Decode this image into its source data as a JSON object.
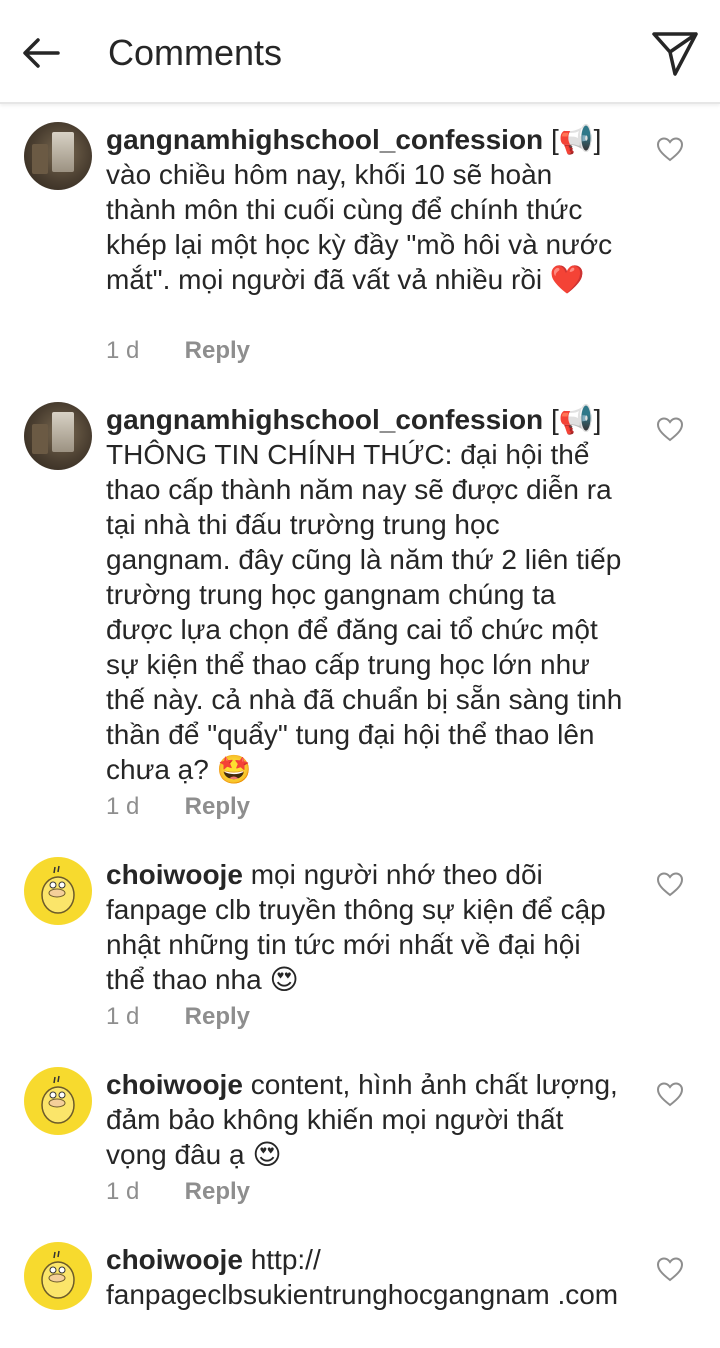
{
  "header": {
    "title": "Comments"
  },
  "comments": [
    {
      "username": "gangnamhighschool_confession",
      "prefix": "[📢]",
      "text": "vào chiều hôm nay, khối 10 sẽ hoàn thành môn thi cuối cùng để chính thức khép lại một học kỳ đầy \"mồ hôi và nước mắt\". mọi người đã vất vả nhiều rồi",
      "emoji": "❤️",
      "time": "1 d",
      "reply_label": "Reply"
    },
    {
      "username": "gangnamhighschool_confession",
      "prefix": "[📢]",
      "text": "THÔNG TIN CHÍNH THỨC: đại hội thể thao cấp thành năm nay sẽ được diễn ra tại nhà thi đấu trường trung học gangnam. đây cũng là năm thứ 2 liên tiếp trường trung học gangnam chúng ta được lựa chọn để đăng cai tổ chức một sự kiện thể thao cấp trung học lớn như thế này. cả nhà đã chuẩn bị sẵn sàng tinh thần để \"quẩy\" tung đại hội thể thao lên chưa ạ?",
      "emoji": "🤩",
      "time": "1 d",
      "reply_label": "Reply"
    },
    {
      "username": "choiwooje",
      "prefix": "",
      "text": "mọi người nhớ theo dõi fanpage clb truyền thông sự kiện để cập nhật những tin tức mới nhất về đại hội thể thao nha",
      "emoji": "😍",
      "time": "1 d",
      "reply_label": "Reply"
    },
    {
      "username": "choiwooje",
      "prefix": "",
      "text": "content, hình ảnh chất lượng, đảm bảo không khiến mọi người thất vọng đâu ạ",
      "emoji": "😍",
      "time": "1 d",
      "reply_label": "Reply"
    },
    {
      "username": "choiwooje",
      "prefix": "",
      "text": "http:// fanpageclbsukientrunghocgangnam .com",
      "emoji": "",
      "time": "",
      "reply_label": ""
    }
  ],
  "icons": {
    "back": "arrow-left-icon",
    "send": "paper-plane-icon",
    "like": "heart-outline-icon",
    "avatar_1": "school-photo-avatar",
    "avatar_2": "psyduck-avatar"
  },
  "colors": {
    "text": "#262626",
    "secondary": "#8e8e8e",
    "heart": "#e0245e",
    "avatar_yellow": "#f7da2e"
  }
}
